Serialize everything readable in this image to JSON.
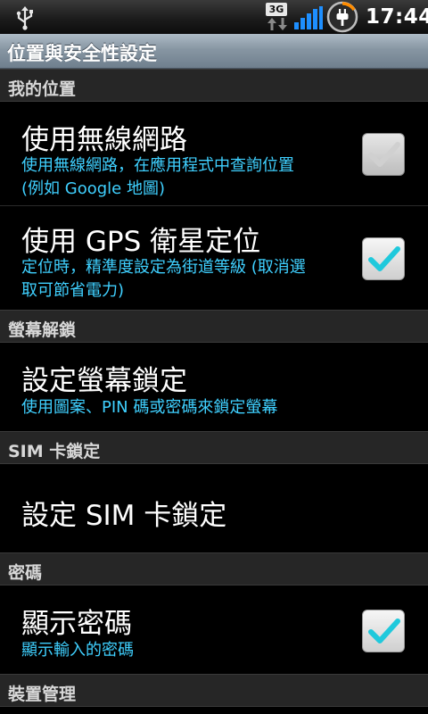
{
  "status_bar": {
    "network_badge": "3G",
    "time": "17:44",
    "icons": [
      "usb-icon",
      "3g-data-icon",
      "signal-strength-icon",
      "battery-charging-icon"
    ]
  },
  "title_bar": {
    "title": "位置與安全性設定"
  },
  "sections": {
    "my_location": {
      "header": "我的位置"
    },
    "screen_unlock": {
      "header": "螢幕解鎖"
    },
    "sim_lock": {
      "header": "SIM 卡鎖定"
    },
    "password": {
      "header": "密碼"
    },
    "device_admin": {
      "header": "裝置管理"
    }
  },
  "items": {
    "wireless_networks": {
      "title": "使用無線網路",
      "summary_line1": "使用無線網路，在應用程式中查詢位置",
      "summary_line2": "(例如 Google 地圖)",
      "checked": false
    },
    "gps": {
      "title": "使用 GPS 衛星定位",
      "summary_line1": "定位時，精準度設定為街道等級 (取消選",
      "summary_line2": "取可節省電力)",
      "checked": true
    },
    "screen_lock": {
      "title": "設定螢幕鎖定",
      "summary": "使用圖案、PIN 碼或密碼來鎖定螢幕"
    },
    "sim_lock": {
      "title": "設定 SIM 卡鎖定"
    },
    "show_password": {
      "title": "顯示密碼",
      "summary": "顯示輸入的密碼",
      "checked": true
    }
  },
  "colors": {
    "summary_text": "#3fd0ff",
    "check_on": "#1fc9dc",
    "check_off": "#d8d8d8"
  }
}
